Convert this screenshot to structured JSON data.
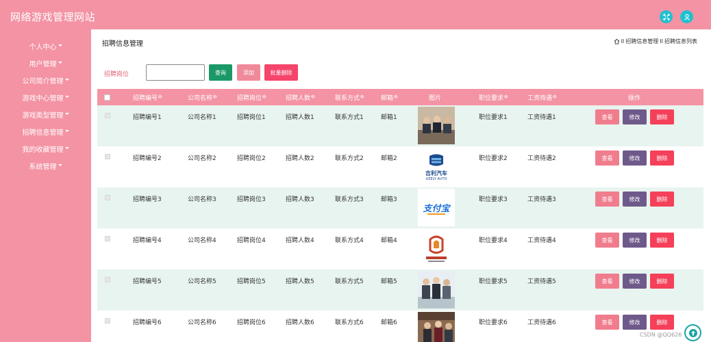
{
  "header": {
    "site_title": "网络游戏管理网站",
    "icons": [
      "fullscreen-icon",
      "user-icon"
    ]
  },
  "sidebar": {
    "items": [
      {
        "label": "个人中心"
      },
      {
        "label": "用户管理"
      },
      {
        "label": "公司简介管理"
      },
      {
        "label": "游戏中心管理"
      },
      {
        "label": "游戏类型管理"
      },
      {
        "label": "招聘信息管理"
      },
      {
        "label": "我的收藏管理"
      },
      {
        "label": "系统管理"
      }
    ]
  },
  "main": {
    "page_title": "招聘信息管理",
    "breadcrumb": [
      "招聘信息管理",
      "招聘信息列表"
    ],
    "search": {
      "label": "招聘岗位",
      "value": "",
      "placeholder": ""
    },
    "buttons": {
      "query": "查询",
      "add": "添加",
      "batch_delete": "批量删除"
    },
    "colors": {
      "primary": "#f393a4",
      "query": "#1a9967",
      "add": "#f08a9a",
      "batch_delete": "#f5456b",
      "view": "#f07d8d",
      "edit": "#6e5a8a",
      "delete": "#f5405a",
      "row_alt": "#e8f4ef"
    }
  },
  "table": {
    "columns": [
      "招聘编号",
      "公司名称",
      "招聘岗位",
      "招聘人数",
      "联系方式",
      "邮箱",
      "图片",
      "职位要求",
      "工资待遇",
      "操作"
    ],
    "action_labels": {
      "view": "查看",
      "edit": "修改",
      "delete": "删除"
    },
    "rows": [
      {
        "id": "招聘编号1",
        "company": "公司名称1",
        "position": "招聘岗位1",
        "count": "招聘人数1",
        "contact": "联系方式1",
        "email": "邮箱1",
        "image": "meeting-photo",
        "requirement": "职位要求1",
        "salary": "工资待遇1"
      },
      {
        "id": "招聘编号2",
        "company": "公司名称2",
        "position": "招聘岗位2",
        "count": "招聘人数2",
        "contact": "联系方式2",
        "email": "邮箱2",
        "image": "geely-logo",
        "logo_text": "吉利汽车",
        "logo_sub": "GEELY AUTO",
        "requirement": "职位要求2",
        "salary": "工资待遇2"
      },
      {
        "id": "招聘编号3",
        "company": "公司名称3",
        "position": "招聘岗位3",
        "count": "招聘人数3",
        "contact": "联系方式3",
        "email": "邮箱3",
        "image": "alipay-logo",
        "logo_text": "支付宝",
        "requirement": "职位要求3",
        "salary": "工资待遇3"
      },
      {
        "id": "招聘编号4",
        "company": "公司名称4",
        "position": "招聘岗位4",
        "count": "招聘人数4",
        "contact": "联系方式4",
        "email": "邮箱4",
        "image": "decoration-logo",
        "requirement": "职位要求4",
        "salary": "工资待遇4"
      },
      {
        "id": "招聘编号5",
        "company": "公司名称5",
        "position": "招聘岗位5",
        "count": "招聘人数5",
        "contact": "联系方式5",
        "email": "邮箱5",
        "image": "team-photo",
        "requirement": "职位要求5",
        "salary": "工资待遇5"
      },
      {
        "id": "招聘编号6",
        "company": "公司名称6",
        "position": "招聘岗位6",
        "count": "招聘人数6",
        "contact": "联系方式6",
        "email": "邮箱6",
        "image": "office-photo",
        "requirement": "职位要求6",
        "salary": "工资待遇6"
      }
    ]
  },
  "watermark": "CSDN @QQ626"
}
